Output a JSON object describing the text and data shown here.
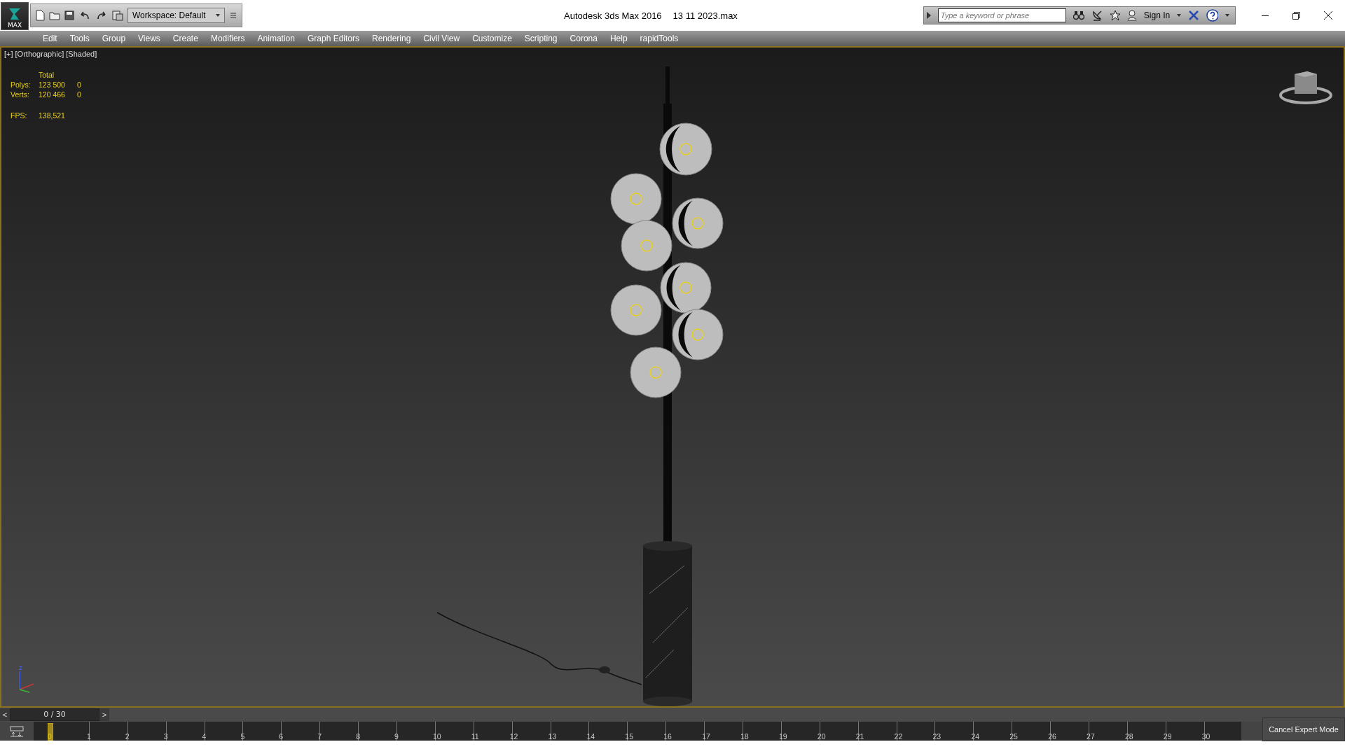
{
  "window": {
    "title": "Autodesk 3ds Max 2016",
    "file": "13 11 2023.max"
  },
  "app_button": {
    "label": "MAX"
  },
  "workspace": {
    "value": "Workspace: Default"
  },
  "search": {
    "placeholder": "Type a keyword or phrase"
  },
  "sign_in": {
    "label": "Sign In"
  },
  "menu": [
    "Edit",
    "Tools",
    "Group",
    "Views",
    "Create",
    "Modifiers",
    "Animation",
    "Graph Editors",
    "Rendering",
    "Civil View",
    "Customize",
    "Scripting",
    "Corona",
    "Help",
    "rapidTools"
  ],
  "viewport": {
    "labels": [
      "[+]",
      "[Orthographic]",
      "[Shaded]"
    ],
    "stats": {
      "header": "Total",
      "rows": [
        {
          "label": "Polys:",
          "value": "123 500",
          "selected_value": "0"
        },
        {
          "label": "Verts:",
          "value": "120 466",
          "selected_value": "0"
        }
      ],
      "fps_label": "FPS:",
      "fps": "138,521"
    },
    "axis": {
      "label": "z"
    }
  },
  "time_slider": {
    "reading": "0 / 30",
    "prev": "<",
    "next": ">",
    "level": 0
  },
  "timeline": {
    "ticks": [
      {
        "label": "0",
        "selected": true
      },
      {
        "label": "1",
        "selected": false
      },
      {
        "label": "2",
        "selected": false
      },
      {
        "label": "3",
        "selected": false
      },
      {
        "label": "4",
        "selected": false
      },
      {
        "label": "5",
        "selected": false
      },
      {
        "label": "6",
        "selected": false
      },
      {
        "label": "7",
        "selected": false
      },
      {
        "label": "8",
        "selected": false
      },
      {
        "label": "9",
        "selected": false
      },
      {
        "label": "10",
        "selected": false
      },
      {
        "label": "11",
        "selected": false
      },
      {
        "label": "12",
        "selected": false
      },
      {
        "label": "13",
        "selected": false
      },
      {
        "label": "14",
        "selected": false
      },
      {
        "label": "15",
        "selected": false
      },
      {
        "label": "16",
        "selected": false
      },
      {
        "label": "17",
        "selected": false
      },
      {
        "label": "18",
        "selected": false
      },
      {
        "label": "19",
        "selected": false
      },
      {
        "label": "20",
        "selected": false
      },
      {
        "label": "21",
        "selected": false
      },
      {
        "label": "22",
        "selected": false
      },
      {
        "label": "23",
        "selected": false
      },
      {
        "label": "24",
        "selected": false
      },
      {
        "label": "25",
        "selected": false
      },
      {
        "label": "26",
        "selected": false
      },
      {
        "label": "27",
        "selected": false
      },
      {
        "label": "28",
        "selected": false
      },
      {
        "label": "29",
        "selected": false
      },
      {
        "label": "30",
        "selected": false
      }
    ]
  },
  "expert_mode": {
    "label": "Cancel Expert Mode"
  }
}
